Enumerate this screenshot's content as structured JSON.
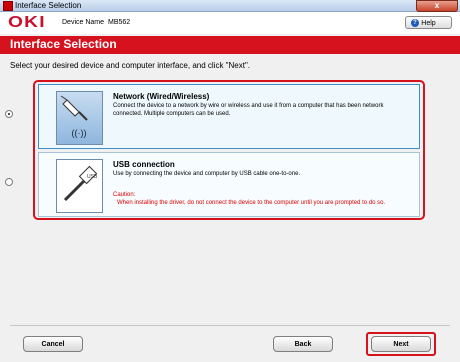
{
  "window": {
    "title": "Interface Selection",
    "close_label": "x"
  },
  "header": {
    "logo": "OKI",
    "device_label": "Device Name",
    "device_value": "MB562",
    "help_label": "Help"
  },
  "banner": {
    "title": "Interface Selection"
  },
  "instruction": "Select your desired device and computer interface, and click \"Next\".",
  "options": [
    {
      "title": "Network (Wired/Wireless)",
      "description": "Connect the device to a network by wire or wireless and use it from a computer that has been network connected. Multiple computers can be used.",
      "selected": true,
      "icon": "network-cable-icon"
    },
    {
      "title": "USB connection",
      "description": "Use by connecting the device and computer by USB cable one-to-one.",
      "caution_label": "Caution:",
      "caution_text": "When installing the driver, do not connect the device to the computer until you are prompted to do so.",
      "selected": false,
      "icon": "usb-cable-icon"
    }
  ],
  "buttons": {
    "cancel": "Cancel",
    "back": "Back",
    "next": "Next"
  },
  "colors": {
    "brand_red": "#d6121e",
    "logo_red": "#c8102e",
    "selection_frame": "#d6121e"
  }
}
